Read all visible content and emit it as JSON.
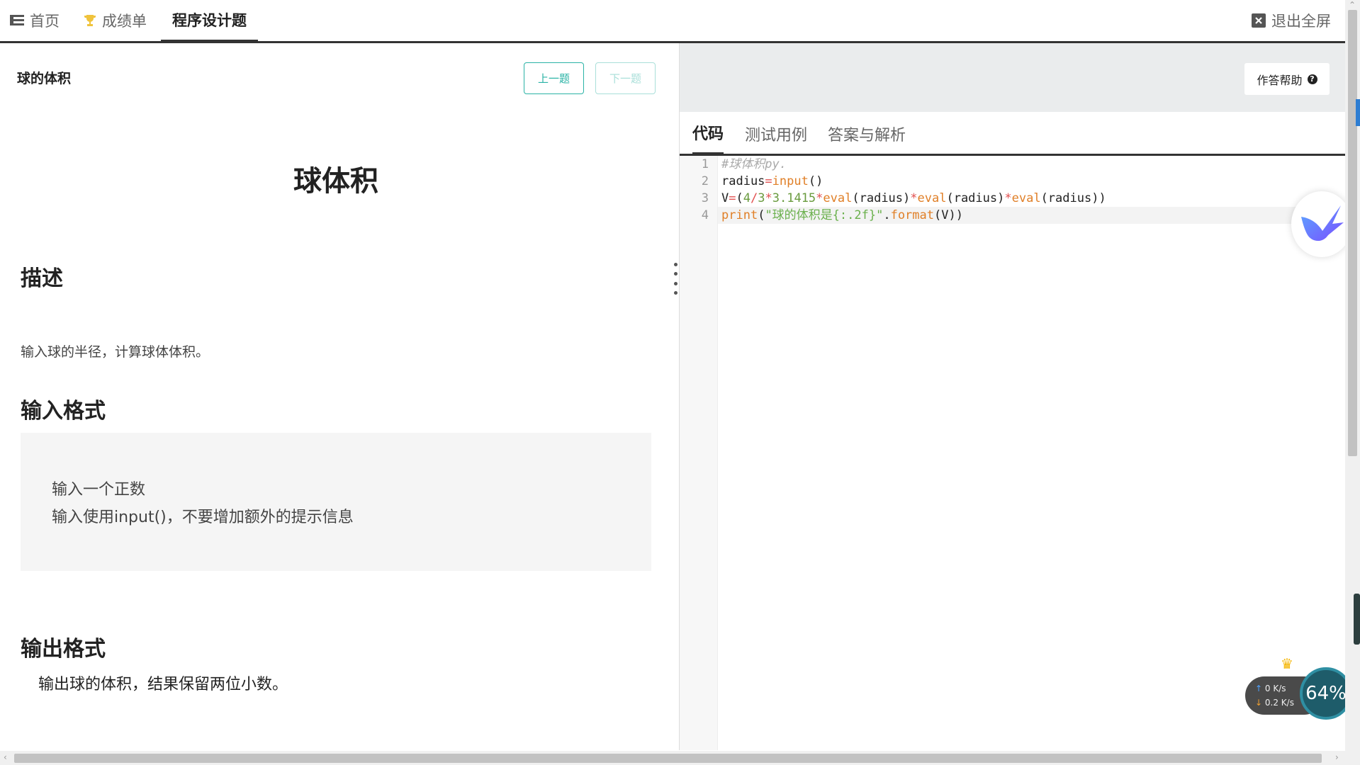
{
  "nav": {
    "tabs": [
      {
        "label": "首页",
        "icon": "list-icon"
      },
      {
        "label": "成绩单",
        "icon": "trophy-icon"
      },
      {
        "label": "程序设计题",
        "icon": ""
      }
    ],
    "exit_fullscreen": "退出全屏"
  },
  "problem": {
    "title": "球的体积",
    "prev_label": "上一题",
    "next_label": "下一题",
    "heading": "球体积",
    "desc_heading": "描述",
    "desc_text": "输入球的半径，计算球体体积。",
    "input_heading": "输入格式",
    "input_lines": [
      "输入一个正数",
      "输入使用input()，不要增加额外的提示信息"
    ],
    "output_heading": "输出格式",
    "output_text": "输出球的体积，结果保留两位小数。"
  },
  "editor": {
    "help_label": "作答帮助",
    "tabs": [
      "代码",
      "测试用例",
      "答案与解析"
    ],
    "line_numbers": [
      "1",
      "2",
      "3",
      "4"
    ],
    "code": [
      "#球体积py.",
      "radius=input()",
      "V=(4/3*3.1415*eval(radius)*eval(radius)*eval(radius))",
      "print(\"球的体积是{:.2f}\".format(V))"
    ]
  },
  "speed_widget": {
    "upload": "0 K/s",
    "download": "0.2 K/s",
    "percent": "64%"
  },
  "colors": {
    "accent": "#2ab3a6",
    "keyword": "#e07f27",
    "operator": "#e25050",
    "string": "#6ab04c"
  }
}
